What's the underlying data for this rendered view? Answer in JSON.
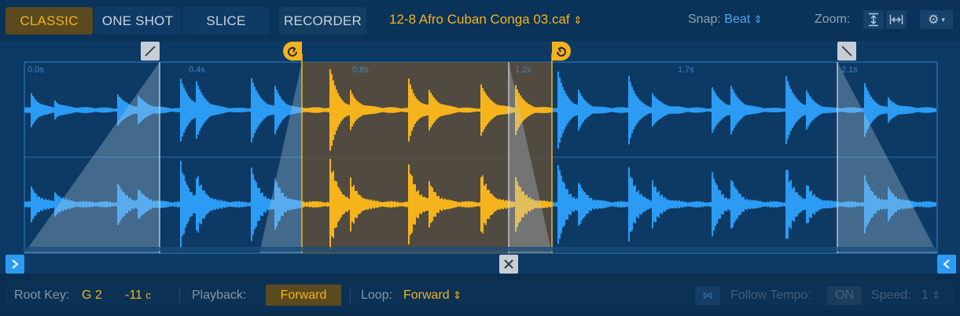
{
  "modes": [
    {
      "label": "CLASSIC",
      "active": true
    },
    {
      "label": "ONE SHOT",
      "active": false
    },
    {
      "label": "SLICE",
      "active": false
    }
  ],
  "recorder_label": "RECORDER",
  "file_name": "12-8 Afro Cuban Conga 03.caf",
  "snap": {
    "label": "Snap:",
    "value": "Beat"
  },
  "zoom_label": "Zoom:",
  "time_ruler": [
    "0.0s",
    "0.4s",
    "0.8s",
    "1.2s",
    "1.7s",
    "2.1s"
  ],
  "root_key": {
    "label": "Root Key:",
    "note": "G 2",
    "cents": "-11",
    "cents_unit": "c"
  },
  "playback": {
    "label": "Playback:",
    "value": "Forward"
  },
  "loop": {
    "label": "Loop:",
    "value": "Forward"
  },
  "follow_tempo": {
    "label": "Follow Tempo:",
    "value": "ON"
  },
  "speed": {
    "label": "Speed:",
    "value": "1"
  },
  "colors": {
    "accent": "#f3b320",
    "wave": "#2b9bf4",
    "background": "#0c3a64"
  },
  "icons": {
    "fade_in": "fade-in-icon",
    "loop_start": "loop-start-icon",
    "loop_end": "loop-end-icon",
    "fade_out": "fade-out-icon",
    "clear_loop": "close-icon",
    "sample_start": "chevron-right-icon",
    "sample_end": "chevron-left-icon"
  }
}
